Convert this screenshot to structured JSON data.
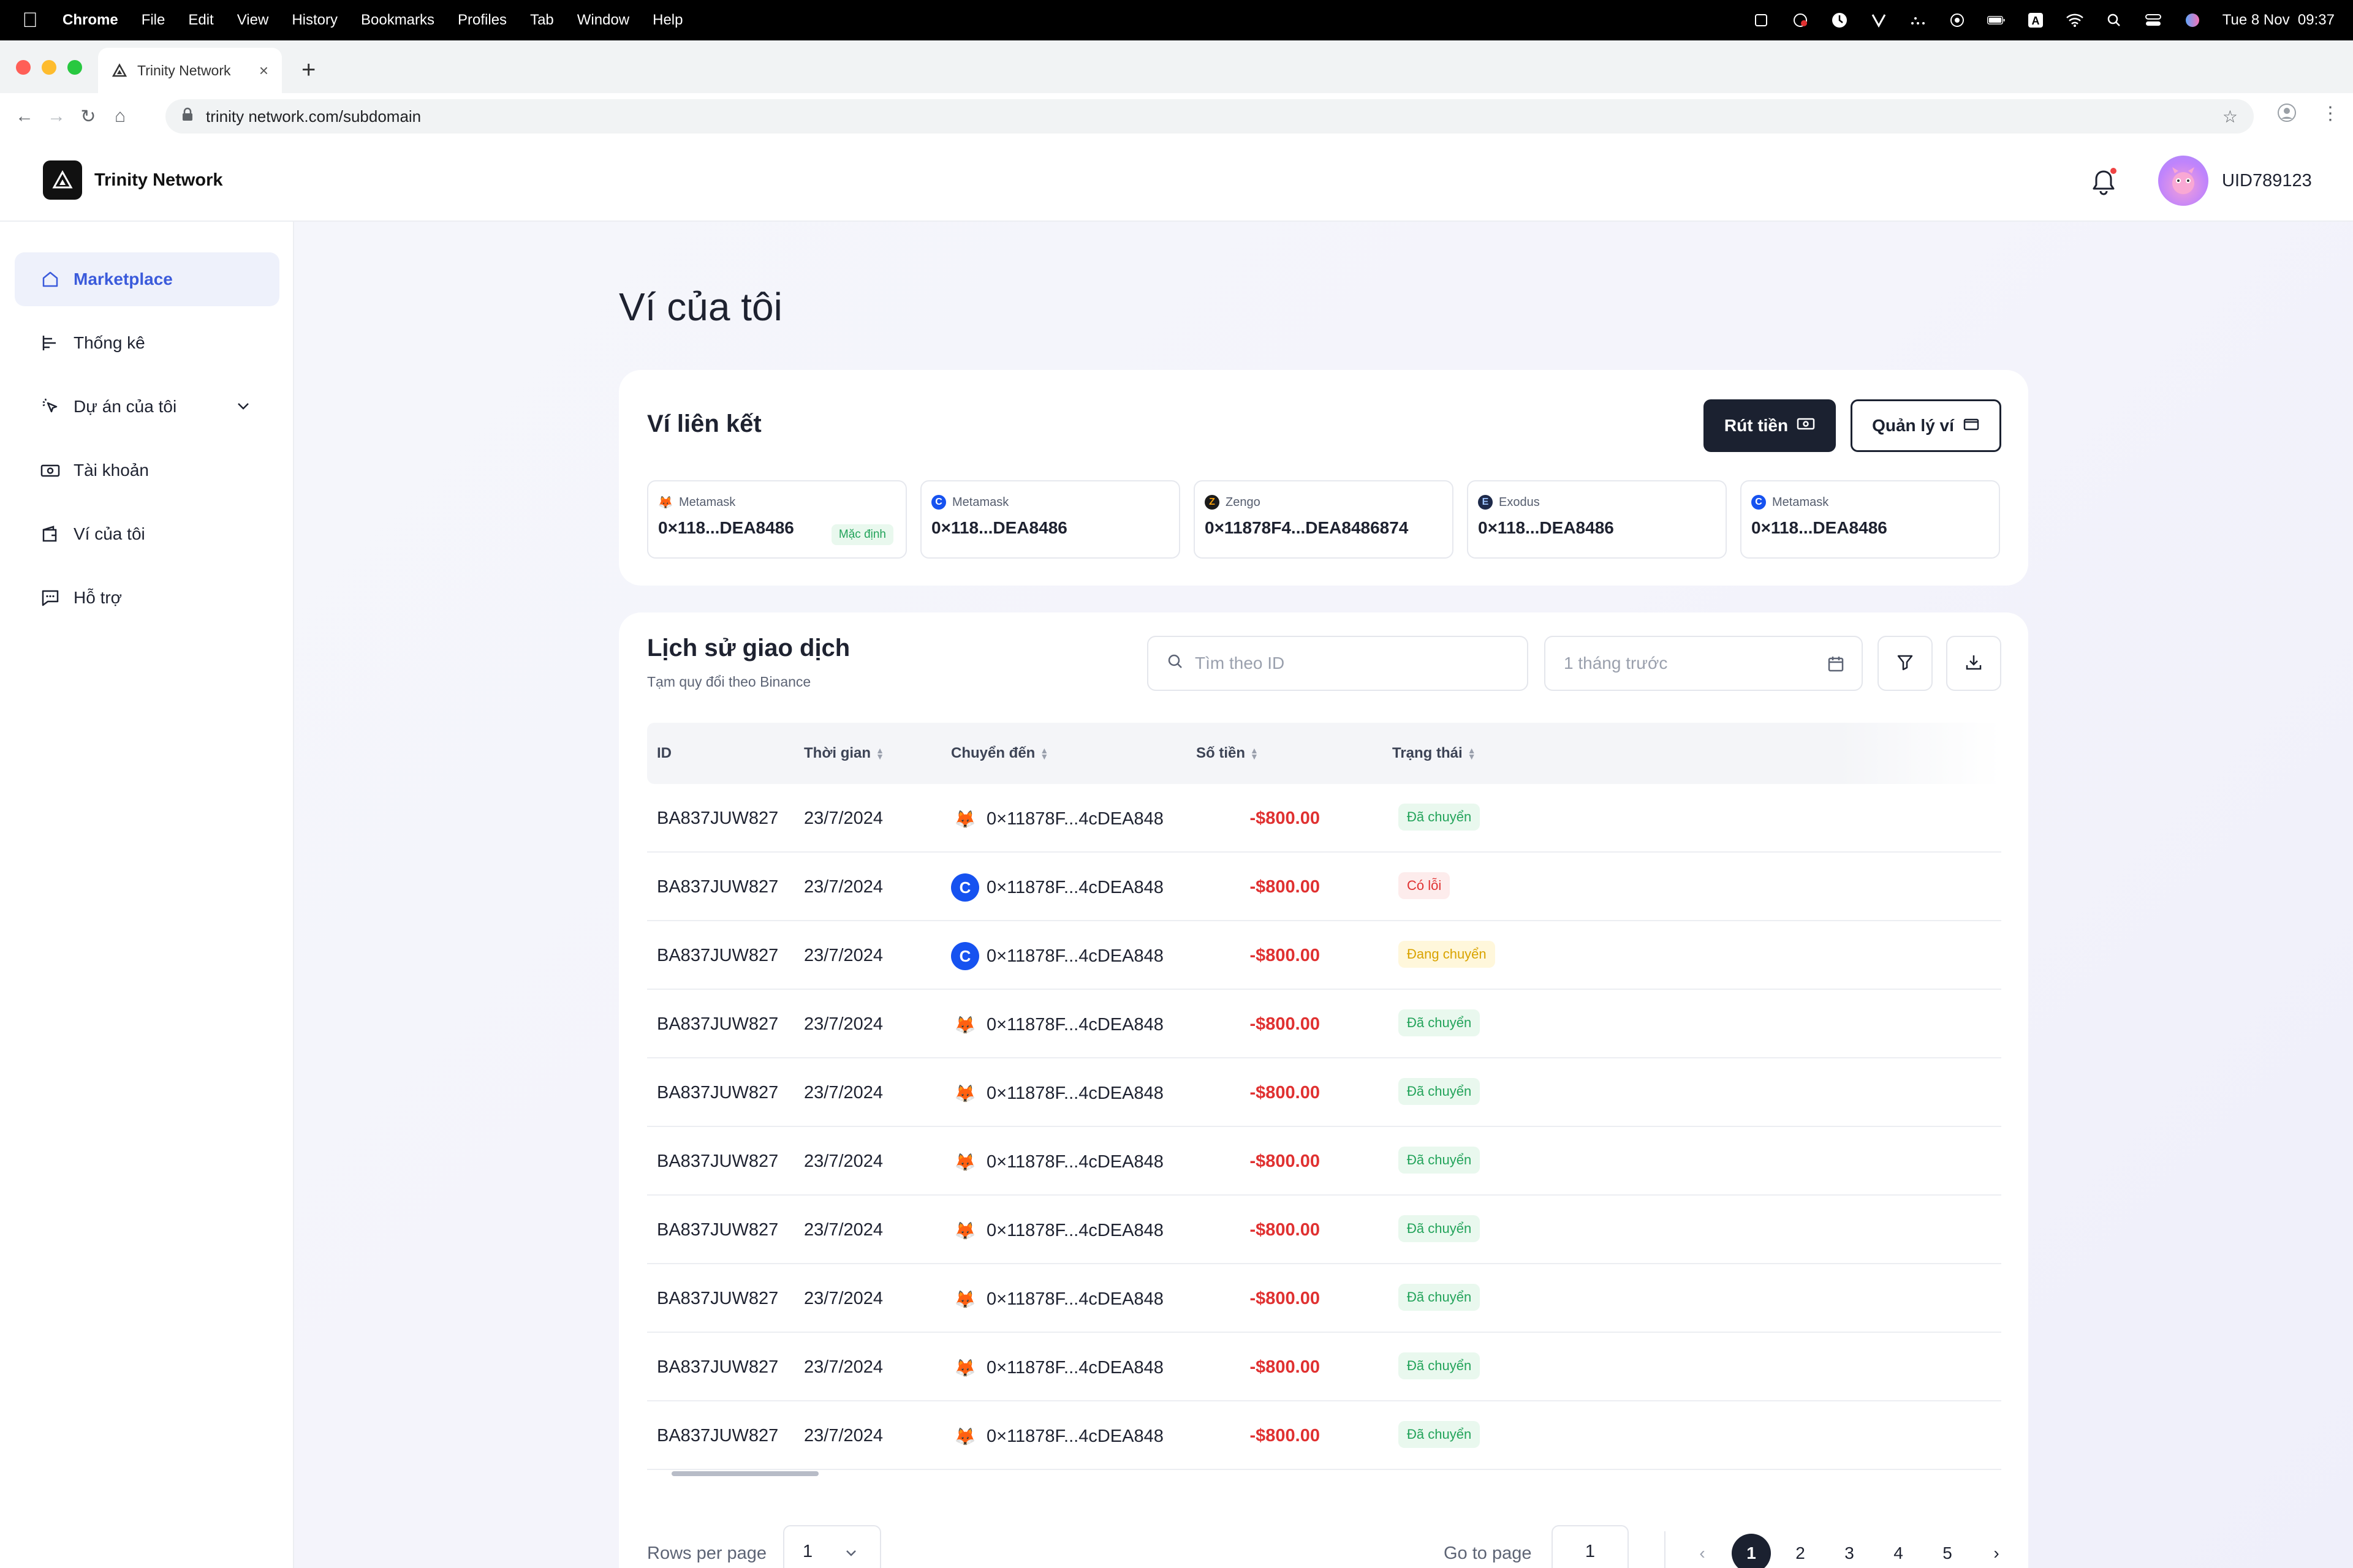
{
  "menubar": {
    "app": "Chrome",
    "items": [
      "File",
      "Edit",
      "View",
      "History",
      "Bookmarks",
      "Profiles",
      "Tab",
      "Window",
      "Help"
    ],
    "datetime": "Tue 8 Nov  09:37"
  },
  "browser": {
    "tab_title": "Trinity Network",
    "url": "trinity network.com/subdomain"
  },
  "header": {
    "brand": "Trinity Network",
    "user_id": "UID789123"
  },
  "sidebar": {
    "items": [
      {
        "label": "Marketplace",
        "icon": "home-icon",
        "active": true
      },
      {
        "label": "Thống kê",
        "icon": "chart-icon"
      },
      {
        "label": "Dự án của tôi",
        "icon": "cursor-icon",
        "expandable": true
      },
      {
        "label": "Tài khoản",
        "icon": "money-icon"
      },
      {
        "label": "Ví của tôi",
        "icon": "wallet-icon"
      },
      {
        "label": "Hỗ trợ",
        "icon": "chat-icon"
      }
    ]
  },
  "page": {
    "title": "Ví của tôi"
  },
  "linked": {
    "title": "Ví liên kết",
    "withdraw_label": "Rút tiền",
    "manage_label": "Quản lý ví",
    "default_label": "Mặc định",
    "wallets": [
      {
        "name": "Metamask",
        "address": "0×118...DEA8486",
        "icon": "metamask-icon"
      },
      {
        "name": "Metamask",
        "address": "0×118...DEA8486",
        "icon": "coinbase-icon"
      },
      {
        "name": "Zengo",
        "address": "0×11878F4...DEA8486874",
        "icon": "zengo-icon"
      },
      {
        "name": "Exodus",
        "address": "0×118...DEA8486",
        "icon": "exodus-icon"
      },
      {
        "name": "Metamask",
        "address": "0×118...DEA8486",
        "icon": "coinbase-icon"
      }
    ]
  },
  "history": {
    "title": "Lịch sử giao dịch",
    "subtitle": "Tạm quy đổi theo Binance",
    "search_placeholder": "Tìm theo ID",
    "date_placeholder": "1 tháng trước",
    "columns": [
      "ID",
      "Thời gian",
      "Chuyển đến",
      "Số tiền",
      "Trạng thái"
    ],
    "rows": [
      {
        "id": "BA837JUW827",
        "date": "23/7/2024",
        "to": "0×11878F...4cDEA848",
        "wallet": "metamask",
        "amount": "-$800.00",
        "status": "Đã chuyển",
        "status_type": "done"
      },
      {
        "id": "BA837JUW827",
        "date": "23/7/2024",
        "to": "0×11878F...4cDEA848",
        "wallet": "coinbase",
        "amount": "-$800.00",
        "status": "Có lỗi",
        "status_type": "err"
      },
      {
        "id": "BA837JUW827",
        "date": "23/7/2024",
        "to": "0×11878F...4cDEA848",
        "wallet": "coinbase",
        "amount": "-$800.00",
        "status": "Đang chuyển",
        "status_type": "pend"
      },
      {
        "id": "BA837JUW827",
        "date": "23/7/2024",
        "to": "0×11878F...4cDEA848",
        "wallet": "metamask",
        "amount": "-$800.00",
        "status": "Đã chuyển",
        "status_type": "done"
      },
      {
        "id": "BA837JUW827",
        "date": "23/7/2024",
        "to": "0×11878F...4cDEA848",
        "wallet": "metamask",
        "amount": "-$800.00",
        "status": "Đã chuyển",
        "status_type": "done"
      },
      {
        "id": "BA837JUW827",
        "date": "23/7/2024",
        "to": "0×11878F...4cDEA848",
        "wallet": "metamask",
        "amount": "-$800.00",
        "status": "Đã chuyển",
        "status_type": "done"
      },
      {
        "id": "BA837JUW827",
        "date": "23/7/2024",
        "to": "0×11878F...4cDEA848",
        "wallet": "metamask",
        "amount": "-$800.00",
        "status": "Đã chuyển",
        "status_type": "done"
      },
      {
        "id": "BA837JUW827",
        "date": "23/7/2024",
        "to": "0×11878F...4cDEA848",
        "wallet": "metamask",
        "amount": "-$800.00",
        "status": "Đã chuyển",
        "status_type": "done"
      },
      {
        "id": "BA837JUW827",
        "date": "23/7/2024",
        "to": "0×11878F...4cDEA848",
        "wallet": "metamask",
        "amount": "-$800.00",
        "status": "Đã chuyển",
        "status_type": "done"
      },
      {
        "id": "BA837JUW827",
        "date": "23/7/2024",
        "to": "0×11878F...4cDEA848",
        "wallet": "metamask",
        "amount": "-$800.00",
        "status": "Đã chuyển",
        "status_type": "done"
      }
    ],
    "rows_per_page_label": "Rows per page",
    "rows_per_page_value": "1",
    "goto_label": "Go to page",
    "goto_value": "1",
    "pages": [
      "1",
      "2",
      "3",
      "4",
      "5"
    ],
    "current_page": "1"
  },
  "colors": {
    "accent": "#3b5bdb",
    "dark": "#1b2130",
    "negative": "#e03131",
    "success": "#22a35a",
    "warning": "#d9a300"
  }
}
